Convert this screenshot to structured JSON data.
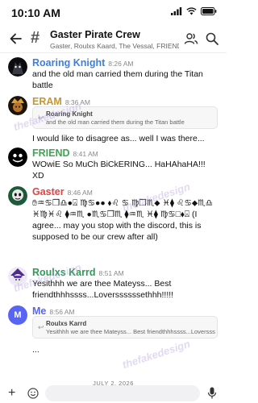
{
  "status_bar": {
    "time": "10:10 AM"
  },
  "header": {
    "title": "Gaster Pirate Crew",
    "members": "Gaster, Roulxs Kaard, The Vessal, FRIEND, Ro..."
  },
  "messages": [
    {
      "author": "Roaring Knight",
      "author_color": "#3d7fe0",
      "time": "8:26 AM",
      "text": "and the old man carried them during the Titan battle"
    },
    {
      "author": "ERAM",
      "author_color": "#c9962b",
      "time": "8:36 AM",
      "reply_author": "Roaring Knight",
      "reply_text": "and the old man carried them during the Titan battle",
      "text": "I would like to disagree as... well I was there..."
    },
    {
      "author": "FRIEND",
      "author_color": "#3ea653",
      "time": "8:41 AM",
      "text": "WOwiE So MuCh BiCkERING... HaHAhaHA!!! XD"
    },
    {
      "author": "Gaster",
      "author_color": "#e04343",
      "time": "8:46 AM",
      "text": "✋︎♒︎♋︎❒︎♎︎●︎⍓︎ ♍︎♋︎●︎● ⬧︎♌︎ ♋︎ ♍︎❒︎♏︎⬥︎ ♓︎⧫︎ ♌︎♋︎⬥︎♏︎♎︎ ♓︎♍︎♓︎♌︎ ⧫︎♒︎♏︎ ●︎♏︎♋︎❒︎♏︎ ⧫︎♒︎♏︎ ♓︎⧫︎ ♍︎♋︎□︎⬧︎⍓︎ (I agree... may you stop with the discord, this is supposed to be our crew after all)"
    },
    {
      "author": "Roulxs Karrd",
      "author_color": "#2f9a57",
      "time": "8:51 AM",
      "text": "Yesithhh we are thee Mateyss... Best friendthhhssss...Loverssssssethhh!!!!!"
    },
    {
      "author": "Me",
      "author_color": "#5865f2",
      "time": "8:56 AM",
      "avatar_letter": "M",
      "reply_author": "Roulxs Karrd",
      "reply_text": "Yesithhh we are thee Mateyss... Best friendthhhssss...Loverssssssethhh",
      "text": "..."
    }
  ],
  "date_divider": "JULY 2, 2026",
  "composer": {
    "placeholder": ""
  },
  "watermark_text": "thefakedesign",
  "colors": {
    "accent": "#5865f2"
  }
}
